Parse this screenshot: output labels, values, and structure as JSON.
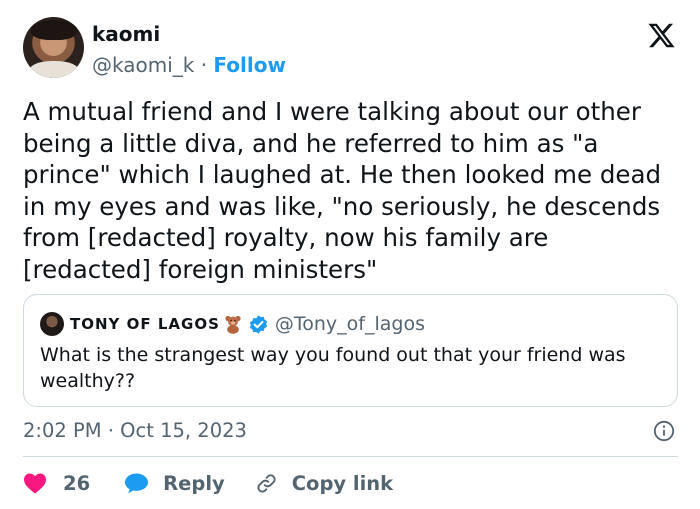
{
  "author": {
    "display_name": "kaomi",
    "handle": "@kaomi_k",
    "separator": " · ",
    "follow_label": "Follow"
  },
  "tweet": {
    "text": "A mutual friend and I were talking about our other being a little diva, and he referred to him  as \"a prince\" which I laughed at. He then looked me dead in my eyes and was like, \"no seriously, he descends from [redacted] royalty, now his family are [redacted] foreign ministers\""
  },
  "quoted_tweet": {
    "display_name": "TONY OF LAGOS",
    "handle": "@Tony_of_lagos",
    "text": "What is the strangest way you found out that your friend was wealthy??"
  },
  "meta": {
    "timestamp": "2:02 PM · Oct 15, 2023"
  },
  "actions": {
    "like_count": "26",
    "reply_label": "Reply",
    "copy_link_label": "Copy link"
  },
  "colors": {
    "accent": "#1d9bf0",
    "like": "#f91880",
    "text": "#0f1419",
    "muted": "#536471",
    "border": "#cfd9de"
  },
  "icons": [
    "x-logo-icon",
    "teddy-bear-icon",
    "verified-badge-icon",
    "info-icon",
    "heart-icon",
    "reply-bubble-icon",
    "link-icon"
  ]
}
